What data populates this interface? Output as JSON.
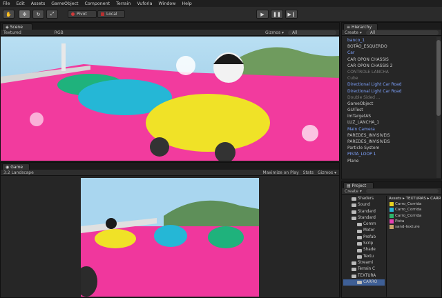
{
  "menu": [
    "File",
    "Edit",
    "Assets",
    "GameObject",
    "Component",
    "Terrain",
    "Vuforia",
    "Window",
    "Help"
  ],
  "toolbar": {
    "pivot_label": "Pivot",
    "local_label": "Local"
  },
  "scene": {
    "tab": "Scene",
    "shading": "Textured",
    "mode": "RGB",
    "gizmos": "Gizmos ▾",
    "all": "All"
  },
  "game": {
    "tab": "Game",
    "aspect": "3:2 Landscape",
    "maximize": "Maximize on Play",
    "stats": "Stats",
    "gizmos": "Gizmos ▾"
  },
  "hierarchy": {
    "tab": "Hierarchy",
    "create": "Create ▾",
    "all": "All",
    "items": [
      {
        "label": "banco_1",
        "type": "prefab"
      },
      {
        "label": "BOTÃO_ESQUERDO",
        "type": "normal"
      },
      {
        "label": "Car",
        "type": "prefab"
      },
      {
        "label": "CAR OPON CHASSIS",
        "type": "normal"
      },
      {
        "label": "CAR OPON CHASSIS 2",
        "type": "normal"
      },
      {
        "label": "CONTROLE LANCHA",
        "type": "dim"
      },
      {
        "label": "Cube",
        "type": "dim"
      },
      {
        "label": "Directional Light Car Road",
        "type": "prefab"
      },
      {
        "label": "Directional Light Car Road",
        "type": "prefab"
      },
      {
        "label": "Double Sided ...",
        "type": "dim"
      },
      {
        "label": "GameObject",
        "type": "normal"
      },
      {
        "label": "GUITest",
        "type": "normal"
      },
      {
        "label": "ImTargetAS",
        "type": "normal"
      },
      {
        "label": "LUZ_LANCHA_1",
        "type": "normal"
      },
      {
        "label": "Main Camera",
        "type": "prefab"
      },
      {
        "label": "PAREDES_INVISIVEIS",
        "type": "normal"
      },
      {
        "label": "PAREDES_INVISIVEIS",
        "type": "normal"
      },
      {
        "label": "Particle System",
        "type": "normal"
      },
      {
        "label": "PISTA_LOOP 1",
        "type": "prefab"
      },
      {
        "label": "Plane",
        "type": "normal"
      }
    ]
  },
  "project": {
    "tab": "Project",
    "create": "Create ▾",
    "folders": [
      "Shaders",
      "Sound",
      "Standard",
      "Standard",
      "Comm",
      "Motor",
      "Prefab",
      "Scrip",
      "Shade",
      "Textu",
      "Streami",
      "Terrain C",
      "TEXTURA",
      "CARRO"
    ],
    "breadcrumb": "Assets ▸ TEXTURAS ▸ CARRO",
    "assets": [
      {
        "label": "Carro_Corrida",
        "color": "#e8d320"
      },
      {
        "label": "Carro_Corrida",
        "color": "#29b7d8"
      },
      {
        "label": "Carro_Corrida",
        "color": "#2db36a"
      },
      {
        "label": "Pista",
        "color": "#e83fb3"
      },
      {
        "label": "sand-texture",
        "color": "#c9a36a"
      }
    ]
  },
  "colors": {
    "road": "#f0379d",
    "sky": "#a9d6ef",
    "yellow_car": "#f0e227",
    "blue_car": "#25b7d6",
    "green_car": "#1fb27c",
    "prefab": "#7fa3ff"
  }
}
